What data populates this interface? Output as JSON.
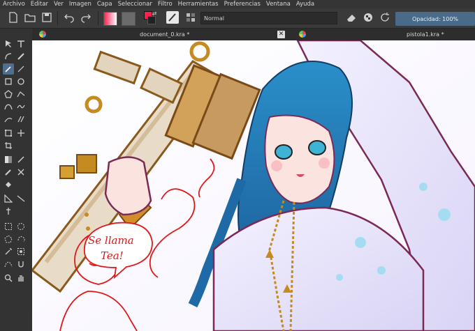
{
  "menu": [
    "Archivo",
    "Editar",
    "Ver",
    "Imagen",
    "Capa",
    "Seleccionar",
    "Filtro",
    "Herramientas",
    "Preferencias",
    "Ventana",
    "Ayuda"
  ],
  "toolbar": {
    "blend_mode": "Normal",
    "opacity_label": "Opacidad: 100%",
    "fg_color": "#ff1f4f",
    "bg_color": "#222222"
  },
  "tabs": [
    {
      "label": "document_0.kra *"
    },
    {
      "label": "pistola1.kra *"
    }
  ],
  "canvas": {
    "speech_text_line1": "Se llama",
    "speech_text_line2": "Tea!"
  }
}
